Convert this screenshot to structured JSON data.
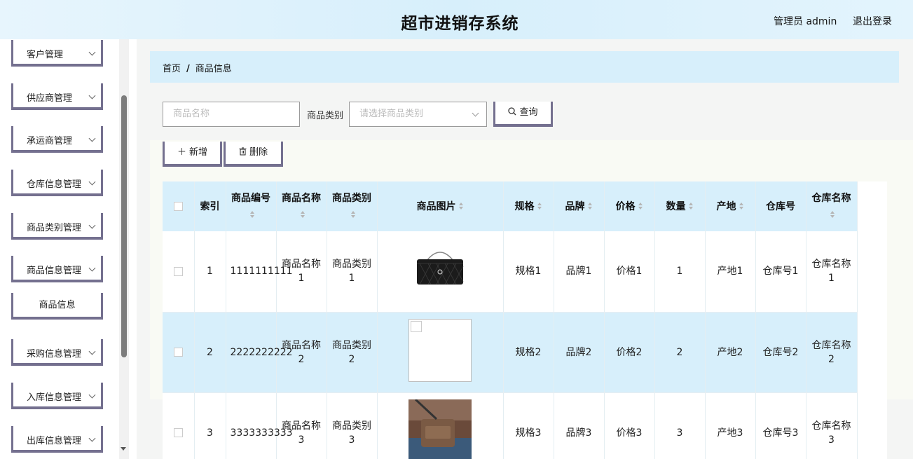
{
  "header": {
    "title": "超市进销存系统",
    "user": "管理员 admin",
    "logout": "退出登录"
  },
  "sidebar": {
    "items": [
      {
        "label": "客户管理"
      },
      {
        "label": "供应商管理"
      },
      {
        "label": "承运商管理"
      },
      {
        "label": "仓库信息管理"
      },
      {
        "label": "商品类别管理"
      },
      {
        "label": "商品信息管理"
      },
      {
        "label": "采购信息管理"
      },
      {
        "label": "入库信息管理"
      },
      {
        "label": "出库信息管理"
      }
    ],
    "sub_item": "商品信息"
  },
  "breadcrumb": {
    "home": "首页",
    "separator": "/",
    "current": "商品信息"
  },
  "search": {
    "name_placeholder": "商品名称",
    "category_label": "商品类别",
    "category_placeholder": "请选择商品类别",
    "query_button": "查询"
  },
  "actions": {
    "add": "新增",
    "delete": "删除"
  },
  "table": {
    "headers": [
      "索引",
      "商品编号",
      "商品名称",
      "商品类别",
      "商品图片",
      "规格",
      "品牌",
      "价格",
      "数量",
      "产地",
      "仓库号",
      "仓库名称"
    ],
    "rows": [
      {
        "index": "1",
        "code": "1111111111",
        "name": "商品名称1",
        "category": "商品类别1",
        "spec": "规格1",
        "brand": "品牌1",
        "price": "价格1",
        "qty": "1",
        "origin": "产地1",
        "wh_no": "仓库号1",
        "wh_name": "仓库名称1"
      },
      {
        "index": "2",
        "code": "2222222222",
        "name": "商品名称2",
        "category": "商品类别2",
        "spec": "规格2",
        "brand": "品牌2",
        "price": "价格2",
        "qty": "2",
        "origin": "产地2",
        "wh_no": "仓库号2",
        "wh_name": "仓库名称2"
      },
      {
        "index": "3",
        "code": "3333333333",
        "name": "商品名称3",
        "category": "商品类别3",
        "spec": "规格3",
        "brand": "品牌3",
        "price": "价格3",
        "qty": "3",
        "origin": "产地3",
        "wh_no": "仓库号3",
        "wh_name": "仓库名称3"
      }
    ]
  },
  "colors": {
    "accent_border": "#74708f",
    "highlight": "#d7effb"
  }
}
